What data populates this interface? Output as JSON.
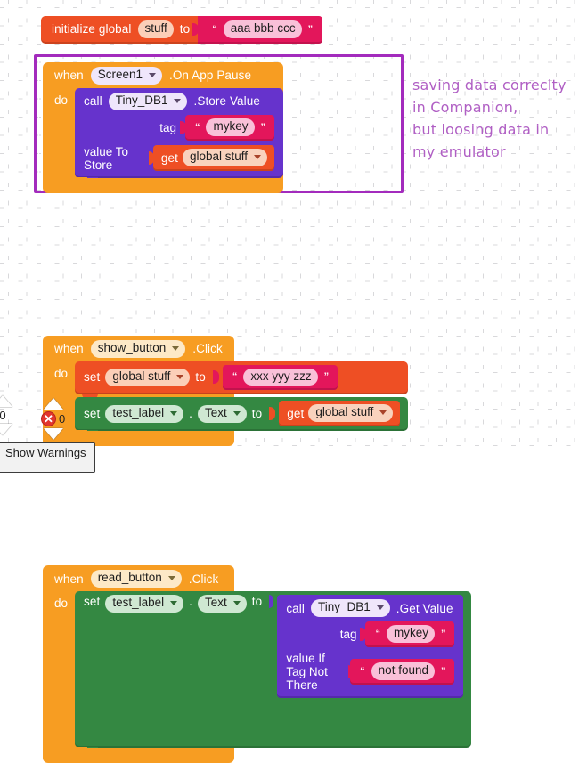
{
  "app": {
    "name": "MIT App Inventor Blocks Editor",
    "canvas_background": "#ffffff",
    "grid_color": "#aaaab0"
  },
  "palette": {
    "event_orange": "#f79d22",
    "variable_red": "#ee4f24",
    "text_pink": "#e3165b",
    "component_purple": "#6633cc",
    "setter_green": "#348842",
    "highlight_purple": "#a32bbd",
    "annotation_purple": "#b05fc4"
  },
  "blocks": {
    "init_global": {
      "keyword": "initialize global",
      "variable_name": "stuff",
      "to_label": "to",
      "value_open_quote": "“",
      "value_close_quote": "”",
      "value_text": "aaa bbb ccc"
    },
    "on_app_pause": {
      "when_label": "when",
      "component": "Screen1",
      "event": ".On App Pause",
      "do_label": "do",
      "call_label": "call",
      "call_component": "Tiny_DB1",
      "call_method": ".Store Value",
      "args": [
        {
          "name": "tag",
          "value_type": "text",
          "open_quote": "“",
          "close_quote": "”",
          "value": "mykey"
        },
        {
          "name": "value To Store",
          "value_type": "get",
          "get_label": "get",
          "value": "global stuff"
        }
      ]
    },
    "show_button_click": {
      "when_label": "when",
      "component": "show_button",
      "event": ".Click",
      "do_label": "do",
      "statements": [
        {
          "kind": "set_global",
          "set_label": "set",
          "target": "global stuff",
          "to_label": "to",
          "value_type": "text",
          "open_quote": "“",
          "close_quote": "”",
          "value": "xxx yyy zzz"
        },
        {
          "kind": "set_property",
          "set_label": "set",
          "target": "test_label",
          "dot": ".",
          "property": "Text",
          "to_label": "to",
          "value_type": "get",
          "get_label": "get",
          "value": "global stuff"
        }
      ]
    },
    "read_button_click": {
      "when_label": "when",
      "component": "read_button",
      "event": ".Click",
      "do_label": "do",
      "statement": {
        "kind": "set_property",
        "set_label": "set",
        "target": "test_label",
        "dot": ".",
        "property": "Text",
        "to_label": "to"
      },
      "call": {
        "call_label": "call",
        "call_component": "Tiny_DB1",
        "call_method": ".Get Value",
        "args": [
          {
            "name": "tag",
            "value_type": "text",
            "open_quote": "“",
            "close_quote": "”",
            "value": "mykey"
          },
          {
            "name": "value If Tag Not There",
            "value_type": "text",
            "open_quote": "“",
            "close_quote": "”",
            "value": "not found"
          }
        ]
      }
    }
  },
  "annotation": {
    "lines": [
      "saving data correclty",
      "in Companion,",
      "but loosing data in",
      "my emulator"
    ]
  },
  "indicators": {
    "left_partial": {
      "warning_count": "0"
    },
    "main": {
      "error_icon": "✕",
      "error_count": "0"
    },
    "show_warnings_button": "Show Warnings"
  }
}
